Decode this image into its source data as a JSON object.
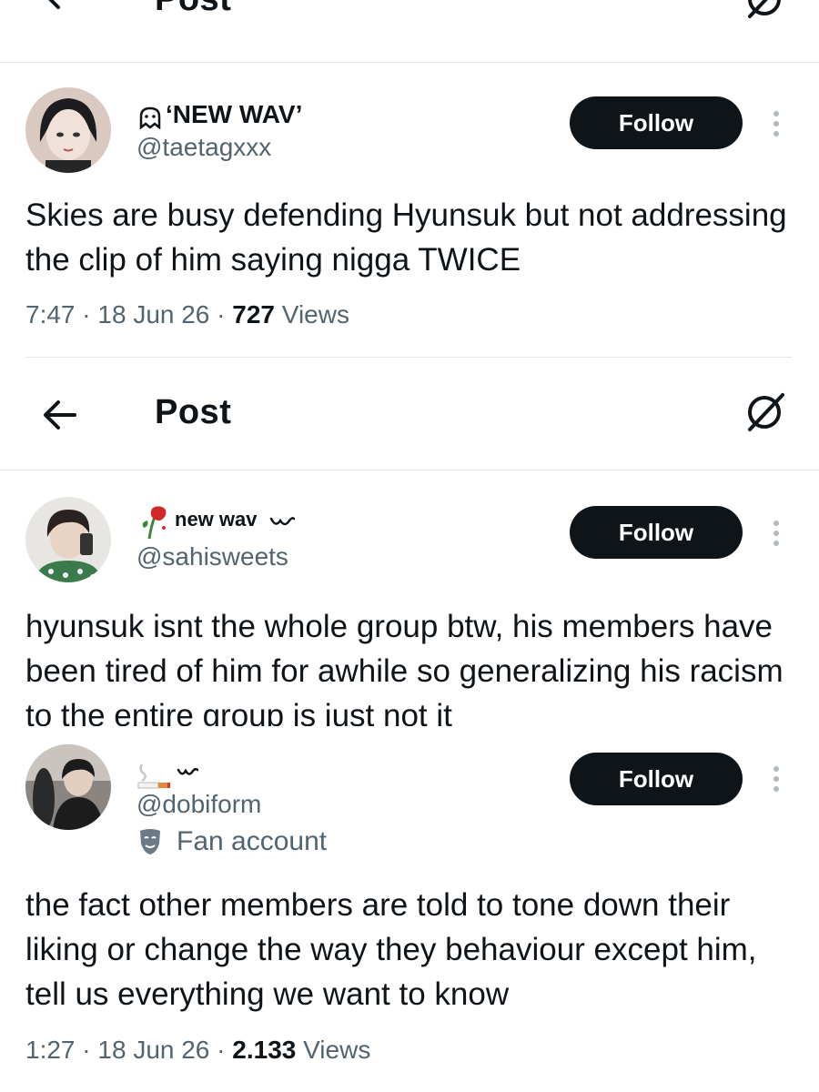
{
  "header_top": {
    "title": "Post"
  },
  "tweet1": {
    "display_name": "‘NEW WAV’",
    "handle": "@taetagxxx",
    "follow_label": "Follow",
    "text": "Skies are busy defending Hyunsuk but not addressing the clip of him saying nigga TWICE",
    "time": "7:47",
    "date": "18 Jun 26",
    "views_count": "727",
    "views_label": "Views"
  },
  "header_mid": {
    "title": "Post"
  },
  "tweet2": {
    "display_name": "new wav",
    "handle": "@sahisweets",
    "follow_label": "Follow",
    "text": "hyunsuk isnt the whole group btw, his members have been tired of him for awhile so generalizing his racism to the entire group is just not it"
  },
  "tweet3": {
    "display_name": "",
    "handle": "@dobiform",
    "badge_label": "Fan account",
    "follow_label": "Follow",
    "text": "the fact other members are told to tone down their liking or change the way they behaviour except him, tell us everything we want to know",
    "time": "1:27",
    "date": "18 Jun 26",
    "views_count": "2.133",
    "views_label": "Views"
  },
  "icons": {
    "back": "arrow-left-icon",
    "grok": "grok-icon",
    "more": "more-vertical-icon",
    "mask": "theater-mask-icon",
    "rose": "rose-emoji-icon",
    "cigarette": "cigarette-emoji-icon",
    "wave": "wave-icon"
  },
  "colors": {
    "text": "#0f1419",
    "secondary": "#536471",
    "button": "#0f1419",
    "divider": "#e6e9ec"
  }
}
